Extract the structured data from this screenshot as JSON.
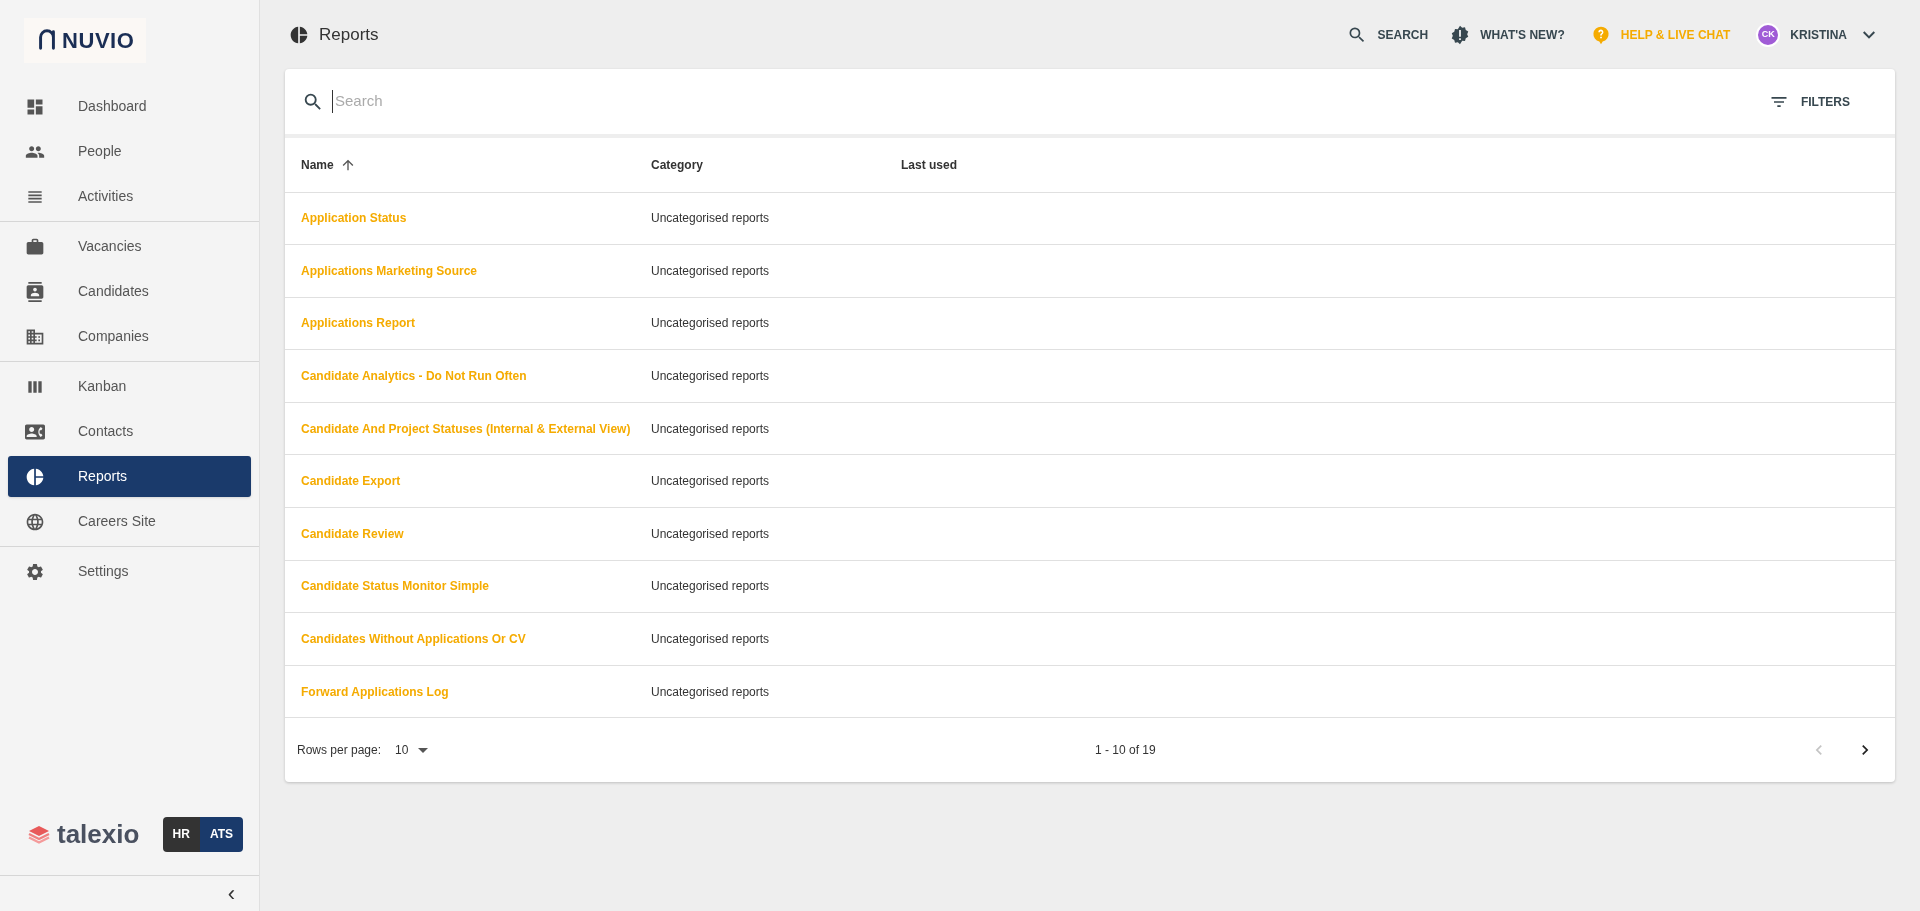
{
  "sidebar": {
    "logo": "NUVIO",
    "sections": [
      {
        "items": [
          {
            "label": "Dashboard",
            "kind": "dashboard",
            "selected": false
          },
          {
            "label": "People",
            "kind": "people",
            "selected": false
          },
          {
            "label": "Activities",
            "kind": "activities",
            "selected": false
          }
        ]
      },
      {
        "items": [
          {
            "label": "Vacancies",
            "kind": "vacancies",
            "selected": false
          },
          {
            "label": "Candidates",
            "kind": "candidates",
            "selected": false
          },
          {
            "label": "Companies",
            "kind": "companies",
            "selected": false
          }
        ]
      },
      {
        "items": [
          {
            "label": "Kanban",
            "kind": "kanban",
            "selected": false
          },
          {
            "label": "Contacts",
            "kind": "contacts",
            "selected": false
          },
          {
            "label": "Reports",
            "kind": "reports",
            "selected": true
          },
          {
            "label": "Careers Site",
            "kind": "careers",
            "selected": false
          }
        ]
      },
      {
        "items": [
          {
            "label": "Settings",
            "kind": "settings",
            "selected": false
          }
        ]
      }
    ],
    "brand": "talexio",
    "switch": [
      {
        "label": "HR",
        "selected": false
      },
      {
        "label": "ATS",
        "selected": true
      }
    ],
    "collapse": "‹"
  },
  "header": {
    "title": "Reports",
    "actions": [
      {
        "kind": "search",
        "label": "SEARCH"
      },
      {
        "kind": "news",
        "label": "WHAT'S NEW?"
      },
      {
        "kind": "help",
        "label": "HELP & LIVE CHAT"
      },
      {
        "kind": "user",
        "initials": "CK",
        "label": "KRISTINA"
      }
    ]
  },
  "table": {
    "search": {
      "placeholder": "Search"
    },
    "filters": "FILTERS",
    "columns": [
      {
        "label": "Name",
        "sorted": true
      },
      {
        "label": "Category",
        "sorted": false
      },
      {
        "label": "Last used",
        "sorted": false
      }
    ],
    "rows": [
      {
        "name": "Application Status",
        "category": "Uncategorised reports"
      },
      {
        "name": "Applications Marketing Source",
        "category": "Uncategorised reports"
      },
      {
        "name": "Applications Report",
        "category": "Uncategorised reports"
      },
      {
        "name": "Candidate Analytics - Do Not Run Often",
        "category": "Uncategorised reports"
      },
      {
        "name": "Candidate And Project Statuses (Internal & External View)",
        "category": "Uncategorised reports"
      },
      {
        "name": "Candidate Export",
        "category": "Uncategorised reports"
      },
      {
        "name": "Candidate Review",
        "category": "Uncategorised reports"
      },
      {
        "name": "Candidate Status Monitor Simple",
        "category": "Uncategorised reports"
      },
      {
        "name": "Candidates Without Applications Or CV",
        "category": "Uncategorised reports"
      },
      {
        "name": "Forward Applications Log",
        "category": "Uncategorised reports"
      }
    ],
    "pagination": {
      "rows_label": "Rows per page:",
      "rows_value": "10",
      "range": "1 - 10 of 19",
      "prev_disabled": true,
      "next_disabled": false
    }
  }
}
